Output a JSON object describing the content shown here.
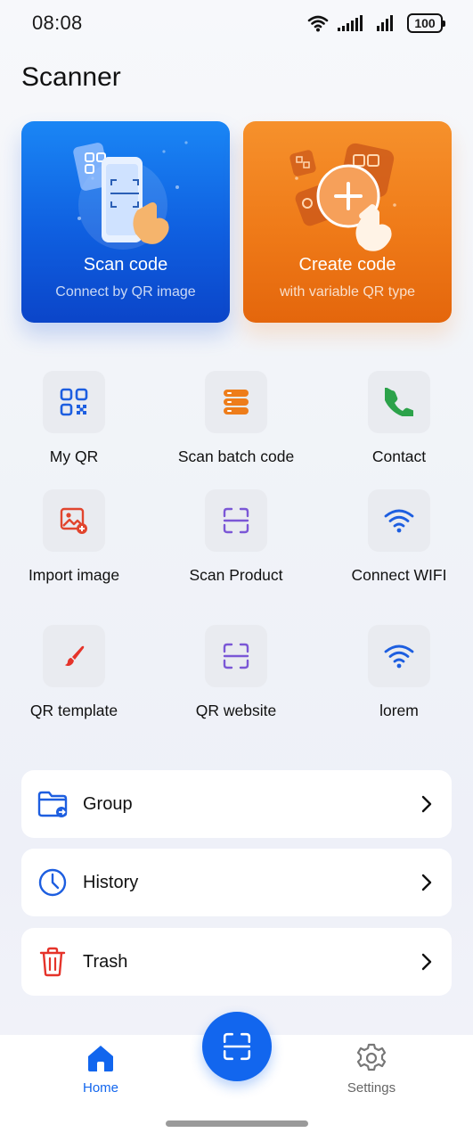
{
  "status_bar": {
    "time": "08:08",
    "battery": "100"
  },
  "page_title": "Scanner",
  "hero": {
    "scan": {
      "title": "Scan code",
      "subtitle": "Connect by QR image",
      "color": "#1266ee"
    },
    "create": {
      "title": "Create code",
      "subtitle": "with variable QR type",
      "color": "#ef7a18"
    }
  },
  "grid": [
    {
      "label": "My QR",
      "icon": "qr-code-icon"
    },
    {
      "label": "Scan batch code",
      "icon": "stack-icon"
    },
    {
      "label": "Contact",
      "icon": "phone-icon"
    },
    {
      "label": "Import image",
      "icon": "image-add-icon"
    },
    {
      "label": "Scan Product",
      "icon": "scan-frame-icon"
    },
    {
      "label": "Connect WIFI",
      "icon": "wifi-icon"
    },
    {
      "label": "QR template",
      "icon": "brush-icon"
    },
    {
      "label": "QR website",
      "icon": "scan-frame-icon"
    },
    {
      "label": "lorem",
      "icon": "wifi-icon"
    }
  ],
  "list": [
    {
      "label": "Group",
      "icon": "folder-icon"
    },
    {
      "label": "History",
      "icon": "clock-icon"
    },
    {
      "label": "Trash",
      "icon": "trash-icon"
    }
  ],
  "nav": {
    "home": {
      "label": "Home",
      "icon": "home-icon",
      "active_color": "#1266ee"
    },
    "settings": {
      "label": "Settings",
      "icon": "gear-icon"
    },
    "scan_button": {
      "icon": "scan-frame-icon"
    }
  }
}
